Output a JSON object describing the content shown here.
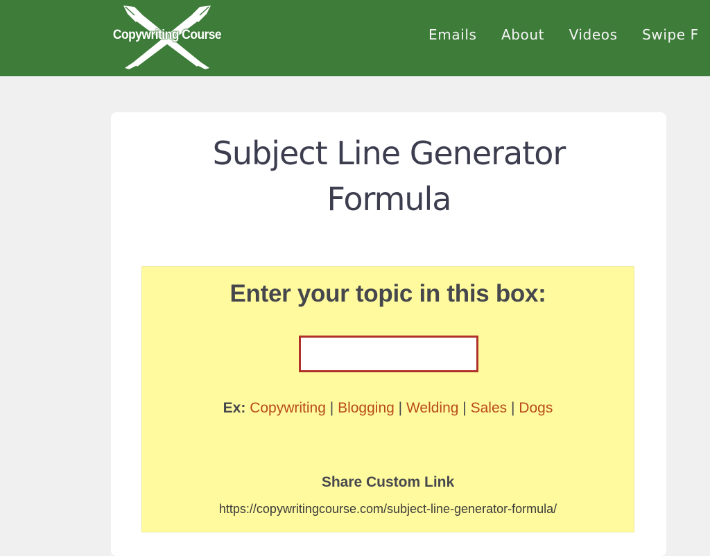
{
  "header": {
    "brand_color": "#3e7c3a",
    "logo": {
      "text": "Copywriting Course",
      "icon": "crossed-pens-icon"
    },
    "nav": [
      {
        "label": "Emails"
      },
      {
        "label": "About"
      },
      {
        "label": "Videos"
      },
      {
        "label": "Swipe F"
      }
    ]
  },
  "main": {
    "title": "Subject Line Generator Formula",
    "generator": {
      "background_color": "#fffa9e",
      "heading": "Enter your topic in this box:",
      "topic_input": {
        "value": "",
        "placeholder": "",
        "border_color": "#b0302a"
      },
      "examples": {
        "label": "Ex:",
        "separator": "|",
        "link_color": "#b84a1a",
        "items": [
          {
            "label": "Copywriting"
          },
          {
            "label": "Blogging"
          },
          {
            "label": "Welding"
          },
          {
            "label": "Sales"
          },
          {
            "label": "Dogs"
          }
        ]
      },
      "share": {
        "title": "Share Custom Link",
        "url": "https://copywritingcourse.com/subject-line-generator-formula/"
      }
    }
  }
}
